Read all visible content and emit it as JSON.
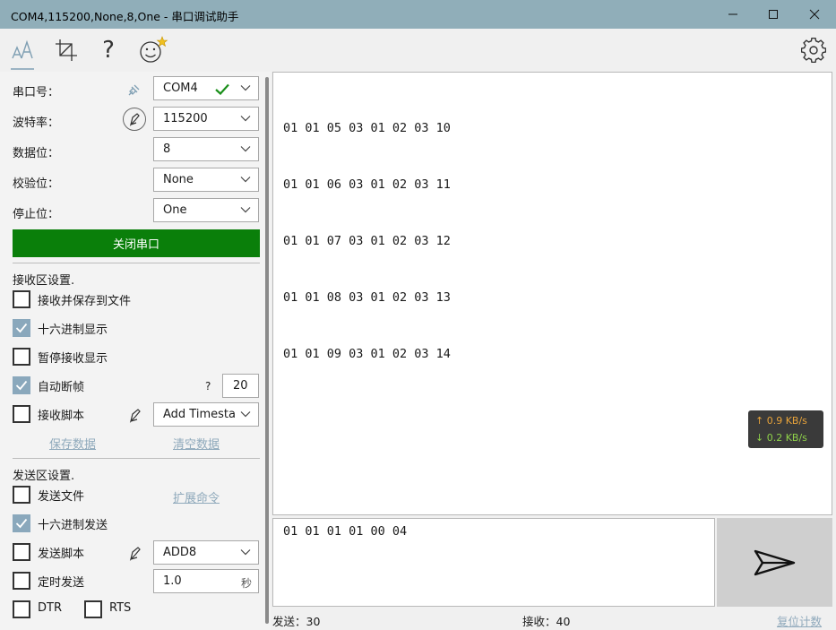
{
  "window": {
    "title": "COM4,115200,None,8,One - 串口调试助手",
    "minimize_icon": "minimize-icon",
    "maximize_icon": "maximize-icon",
    "close_icon": "close-icon"
  },
  "toolbar": {
    "items": [
      "font-size-icon",
      "crop-icon",
      "help-icon",
      "smiley-icon"
    ],
    "help_glyph": "?",
    "settings_icon": "gear-icon"
  },
  "serial": {
    "port_label": "串口号：",
    "port_value": "COM4",
    "baud_label": "波特率：",
    "baud_value": "115200",
    "databits_label": "数据位：",
    "databits_value": "8",
    "parity_label": "校验位：",
    "parity_value": "None",
    "stopbits_label": "停止位：",
    "stopbits_value": "One",
    "toggle_button": "关闭串口"
  },
  "receive_settings": {
    "heading": "接收区设置.",
    "save_to_file": {
      "label": "接收并保存到文件",
      "checked": false
    },
    "hex_display": {
      "label": "十六进制显示",
      "checked": true
    },
    "pause_display": {
      "label": "暂停接收显示",
      "checked": false
    },
    "auto_frame": {
      "label": "自动断帧",
      "checked": true
    },
    "auto_frame_help": "?",
    "auto_frame_value": "20",
    "recv_script": {
      "label": "接收脚本",
      "checked": false
    },
    "recv_script_value": "Add Timestamp",
    "save_data_link": "保存数据",
    "clear_data_link": "清空数据"
  },
  "send_settings": {
    "heading": "发送区设置.",
    "send_file": {
      "label": "发送文件",
      "checked": false
    },
    "extend_cmd_link": "扩展命令",
    "hex_send": {
      "label": "十六进制发送",
      "checked": true
    },
    "send_script": {
      "label": "发送脚本",
      "checked": false
    },
    "send_script_value": "ADD8",
    "timed_send": {
      "label": "定时发送",
      "checked": false
    },
    "timed_value": "1.0",
    "timed_unit": "秒",
    "dtr": {
      "label": "DTR",
      "checked": false
    },
    "rts": {
      "label": "RTS",
      "checked": false
    }
  },
  "receive_area": {
    "lines": [
      "01 01 05 03 01 02 03 10",
      "01 01 06 03 01 02 03 11",
      "01 01 07 03 01 02 03 12",
      "01 01 08 03 01 02 03 13",
      "01 01 09 03 01 02 03 14"
    ],
    "speed_up": "↑ 0.9 KB/s",
    "speed_down": "↓ 0.2 KB/s"
  },
  "send_area": {
    "text": "01 01 01 01 00 04",
    "send_icon": "send-icon"
  },
  "status": {
    "sent": "发送：30",
    "received": "接收：40",
    "reset_link": "复位计数"
  },
  "colors": {
    "titlebar": "#90aeb9",
    "open_button": "#0a7f0a",
    "checkbox_checked": "#8aa8bc",
    "link": "#8fa9bb",
    "speed_up": "#e8a33a",
    "speed_down": "#8fd14a"
  }
}
